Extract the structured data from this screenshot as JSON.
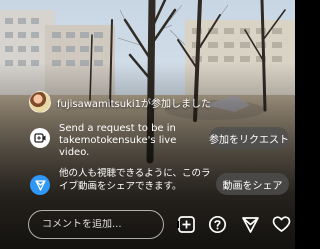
{
  "live": {
    "join_message": "fujisawamitsuki1が参加しました",
    "request": {
      "text": "Send a request to be in takemotokensuke's live video.",
      "button_label": "参加をリクエスト"
    },
    "share": {
      "text": "他の人も視聴できるように、このライブ動画をシェアできます。",
      "button_label": "動画をシェア"
    },
    "comment": {
      "placeholder": "コメントを追加..."
    },
    "toolbar": [
      "add-media-icon",
      "question-icon",
      "send-icon",
      "heart-icon"
    ]
  }
}
